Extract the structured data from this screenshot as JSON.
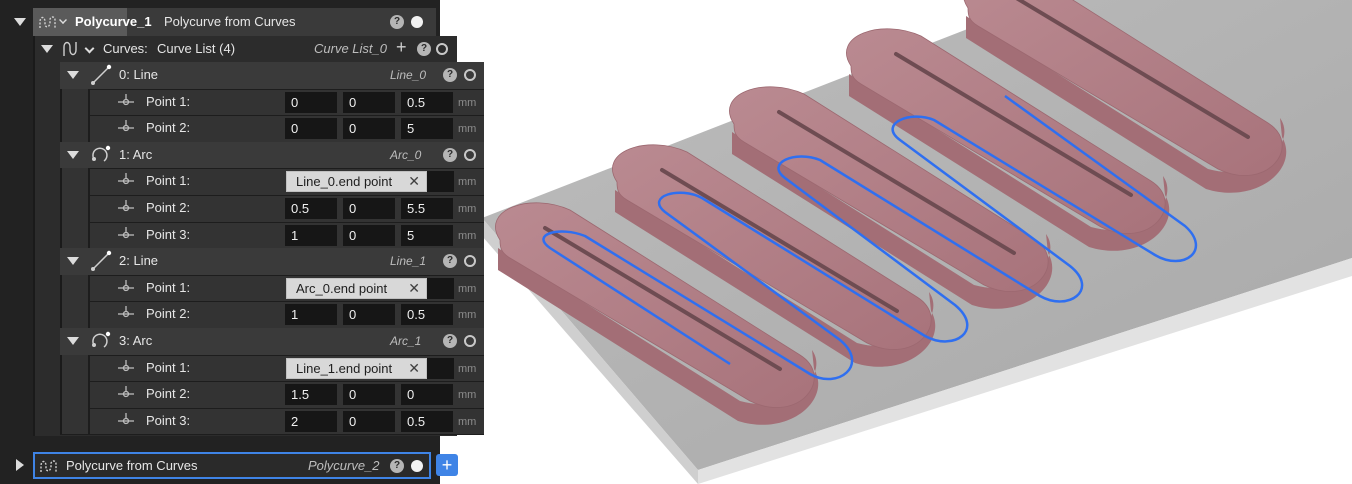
{
  "root": {
    "name": "Polycurve_1",
    "type_label": "Polycurve from Curves",
    "help": "?"
  },
  "curves": {
    "label": "Curves:",
    "value": "Curve List (4)",
    "name": "Curve List_0",
    "add": "+"
  },
  "items": [
    {
      "header": "0:  Line",
      "name": "Line_0",
      "points": [
        {
          "label": "Point 1:",
          "values": [
            "0",
            "0",
            "0.5"
          ],
          "unit": "mm"
        },
        {
          "label": "Point 2:",
          "values": [
            "0",
            "0",
            "5"
          ],
          "unit": "mm"
        }
      ]
    },
    {
      "header": "1:  Arc",
      "name": "Arc_0",
      "points": [
        {
          "label": "Point 1:",
          "ref": "Line_0.end point",
          "unit": "mm"
        },
        {
          "label": "Point 2:",
          "values": [
            "0.5",
            "0",
            "5.5"
          ],
          "unit": "mm"
        },
        {
          "label": "Point 3:",
          "values": [
            "1",
            "0",
            "5"
          ],
          "unit": "mm"
        }
      ]
    },
    {
      "header": "2:  Line",
      "name": "Line_1",
      "points": [
        {
          "label": "Point 1:",
          "ref": "Arc_0.end point",
          "unit": "mm"
        },
        {
          "label": "Point 2:",
          "values": [
            "1",
            "0",
            "0.5"
          ],
          "unit": "mm"
        }
      ]
    },
    {
      "header": "3:  Arc",
      "name": "Arc_1",
      "points": [
        {
          "label": "Point 1:",
          "ref": "Line_1.end point",
          "unit": "mm"
        },
        {
          "label": "Point 2:",
          "values": [
            "1.5",
            "0",
            "0"
          ],
          "unit": "mm"
        },
        {
          "label": "Point 3:",
          "values": [
            "2",
            "0",
            "0.5"
          ],
          "unit": "mm"
        }
      ]
    }
  ],
  "next": {
    "type_label": "Polycurve from Curves",
    "name": "Polycurve_2",
    "add": "+"
  },
  "ref_clear": "✕",
  "colors": {
    "panel_bg": "#222222",
    "accent": "#3f84e6",
    "body_fill": "#b07a82",
    "plate_fill": "#b3b3b3",
    "curve": "#2f6ff0"
  }
}
